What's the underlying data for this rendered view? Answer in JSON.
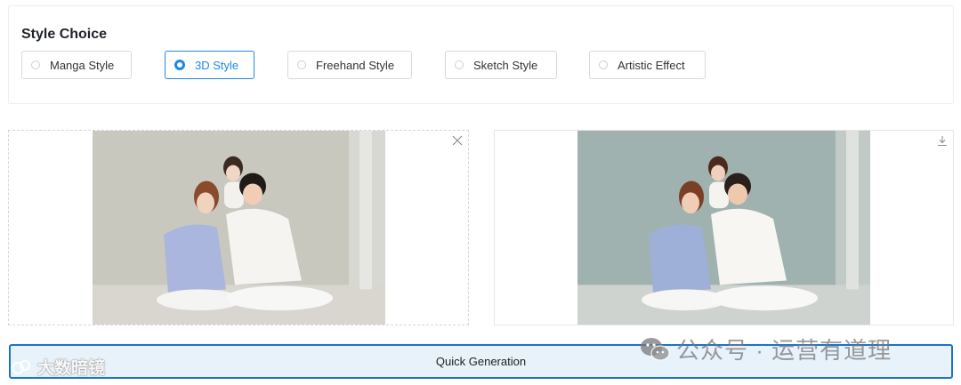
{
  "style_choice": {
    "title": "Style Choice",
    "options": [
      {
        "label": "Manga Style",
        "selected": false
      },
      {
        "label": "3D Style",
        "selected": true
      },
      {
        "label": "Freehand Style",
        "selected": false
      },
      {
        "label": "Sketch Style",
        "selected": false
      },
      {
        "label": "Artistic Effect",
        "selected": false
      }
    ]
  },
  "icons": {
    "remove": "close-icon",
    "download": "download-icon"
  },
  "generate": {
    "label": "Quick Generation"
  },
  "colors": {
    "accent": "#1e88e5",
    "button_bg": "#e7f2fb",
    "button_border": "#1a73c9"
  },
  "watermarks": {
    "left": "大数暗镜",
    "right": "公众号 · 运营有道理"
  }
}
